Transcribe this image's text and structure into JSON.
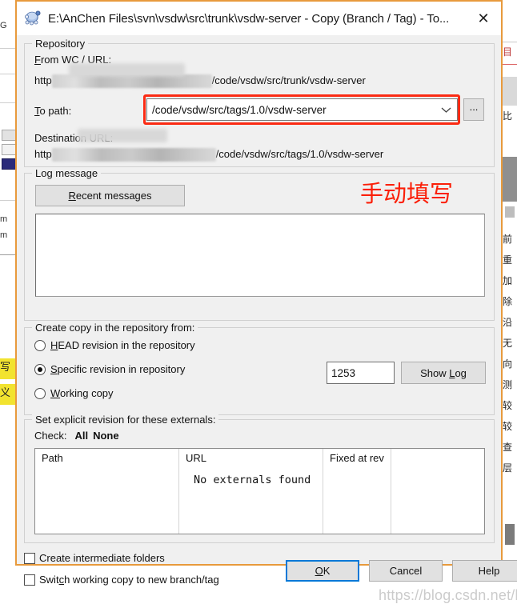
{
  "window": {
    "title": "E:\\AnChen Files\\svn\\vsdw\\src\\trunk\\vsdw-server - Copy (Branch / Tag) - To...",
    "icon": "tortoisesvn-turtle-icon",
    "close_label": "✕",
    "border_color": "#e89a3c"
  },
  "repository": {
    "legend": "Repository",
    "from_label": "From WC / URL:",
    "from_url_prefix": "http",
    "from_url_suffix": "/code/vsdw/src/trunk/vsdw-server",
    "to_path_label": "To path:",
    "to_path_value": "/code/vsdw/src/tags/1.0/vsdw-server",
    "dropdown_icon": "chevron-down-icon",
    "browse_label": "...",
    "destination_label": "Destination URL:",
    "destination_url_prefix": "http",
    "destination_url_suffix": "/code/vsdw/src/tags/1.0/vsdw-server",
    "highlight_color": "#fb2b14",
    "annotation": "手动填写"
  },
  "log_message": {
    "legend": "Log message",
    "recent_messages_label": "Recent messages",
    "textarea_value": "",
    "textarea_placeholder": ""
  },
  "create_copy": {
    "legend": "Create copy in the repository from:",
    "options": [
      {
        "label": "HEAD revision in the repository",
        "selected": false
      },
      {
        "label": "Specific revision in repository",
        "selected": true
      },
      {
        "label": "Working copy",
        "selected": false
      }
    ],
    "revision_value": "1253",
    "show_log_label": "Show Log"
  },
  "externals": {
    "legend": "Set explicit revision for these externals:",
    "check_label": "Check:",
    "check_all_label": "All",
    "check_none_label": "None",
    "columns": [
      "Path",
      "URL",
      "Fixed at rev",
      ""
    ],
    "empty_message": "No externals found",
    "rows": []
  },
  "footer": {
    "checkboxes": [
      {
        "label": "Create intermediate folders",
        "checked": false
      },
      {
        "label": "Switch working copy to new branch/tag",
        "checked": false
      }
    ],
    "ok_label": "OK",
    "cancel_label": "Cancel",
    "help_label": "Help",
    "focus_color": "#0078d7"
  },
  "watermark": {
    "text": "https://blog.csdn.net/lilliuyang"
  },
  "background": {
    "left_fragments": [
      "G",
      "m",
      "m"
    ],
    "left_highlight": [
      "写",
      "义"
    ],
    "right_fragments": [
      "目",
      "比",
      "前",
      "重",
      "加",
      "除",
      "沿",
      "无",
      "向",
      "测",
      "较",
      "较",
      "查",
      "层"
    ]
  }
}
